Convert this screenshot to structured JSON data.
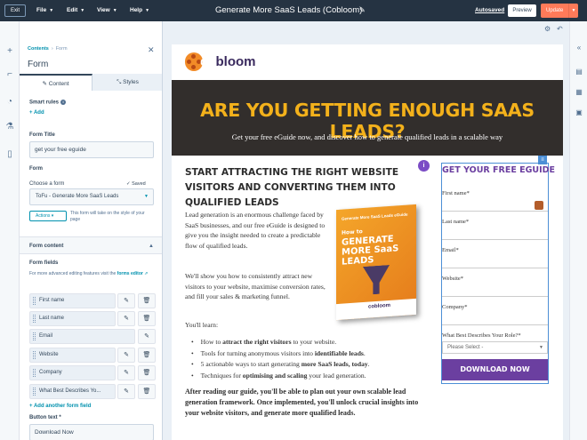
{
  "topbar": {
    "exit_label": "Exit",
    "menus": [
      "File",
      "Edit",
      "View",
      "Help"
    ],
    "title": "Generate More SaaS Leads (Cobloom)",
    "autosaved": "Autosaved",
    "preview": "Preview",
    "update": "Update"
  },
  "panel": {
    "breadcrumb_root": "Contents",
    "breadcrumb_current": "Form",
    "title": "Form",
    "tabs": [
      "Content",
      "Styles"
    ],
    "smart_rules_label": "Smart rules",
    "add_label": "Add",
    "form_title_label": "Form Title",
    "form_title_value": "get your free eguide",
    "form_label": "Form",
    "choose_form_label": "Choose a form",
    "saved_label": "Saved",
    "selected_form": "ToFu - Generate More SaaS Leads",
    "actions_label": "Actions",
    "style_note": "This form will take on the style of your page",
    "form_content_label": "Form content",
    "form_fields_label": "Form fields",
    "advanced_note": "For more advanced editing features visit the",
    "forms_editor_link": "forms editor",
    "fields": [
      "First name",
      "Last name",
      "Email",
      "Website",
      "Company",
      "What Best Describes Yo..."
    ],
    "add_field_label": "Add another form field",
    "button_text_label": "Button text *",
    "button_text_value": "Download Now"
  },
  "page": {
    "logo_prefix": "co",
    "logo_suffix": "bloom",
    "hero_title": "ARE YOU GETTING ENOUGH SAAS LEADS?",
    "hero_subtitle": "Get your free eGuide now, and discover how to generate qualified leads in a scalable way",
    "content_heading": "START ATTRACTING THE RIGHT WEBSITE VISITORS AND CONVERTING THEM INTO QUALIFIED LEADS",
    "info_badge": "i",
    "para1": "Lead generation is an enormous challenge faced by SaaS businesses, and our free eGuide is designed to give you the insight needed to create a predictable flow of qualified leads.",
    "para2": "We'll show you how to consistently attract new visitors to your website, maximise conversion rates, and fill your sales & marketing funnel.",
    "youll_learn": "You'll learn:",
    "bullets": [
      {
        "pre": "How to ",
        "bold": "attract the right visitors",
        "post": " to your website."
      },
      {
        "pre": "Tools for turning anonymous visitors into ",
        "bold": "identifiable leads",
        "post": "."
      },
      {
        "pre": "5 actionable ways to start generating ",
        "bold": "more SaaS leads, today",
        "post": "."
      },
      {
        "pre": "Techniques for ",
        "bold": "optimising and scaling",
        "post": " your lead generation."
      }
    ],
    "closing": "After reading our guide, you'll be able to plan out your own scalable lead generation framework. Once implemented, you'll unlock crucial insights into your website visitors, and generate more qualified leads.",
    "book": {
      "top": "Generate More SaaS Leads eGuide",
      "title_small": "How to",
      "title_big": "GENERATE MORE SaaS LEADS",
      "logo": "cobloom"
    },
    "form": {
      "title": "GET YOUR FREE EGUIDE",
      "fields": [
        "First name*",
        "Last name*",
        "Email*",
        "Website*",
        "Company*",
        "What Best Describes Your Role?*"
      ],
      "select_placeholder": "Please Select -",
      "button": "DOWNLOAD NOW"
    }
  },
  "colors": {
    "topbar": "#253342",
    "accent_orange": "#ff7a59",
    "hero_bg": "#322e2c",
    "hero_title": "#f3b11b",
    "brand_purple": "#6b3fa0",
    "link": "#0091ae"
  }
}
